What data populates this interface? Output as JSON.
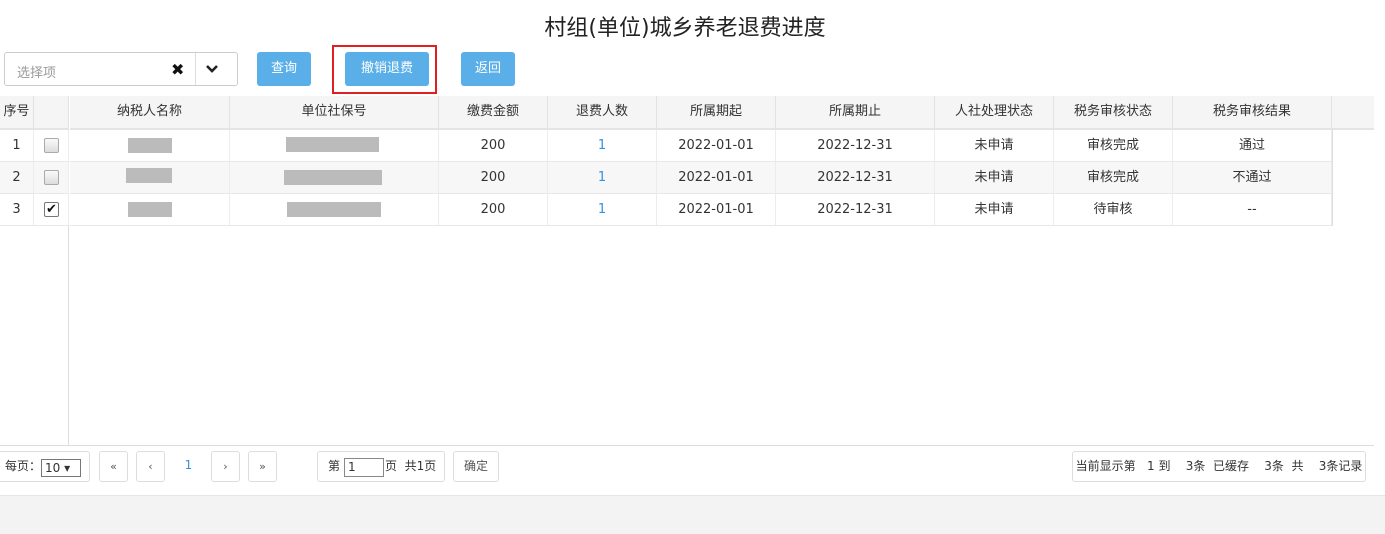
{
  "page_title": "村组(单位)城乡养老退费进度",
  "toolbar": {
    "select_placeholder": "选择项",
    "clear_icon": "✖",
    "query_label": "查询",
    "revoke_label": "撤销退费",
    "back_label": "返回"
  },
  "table": {
    "headers": {
      "seq": "序号",
      "name": "纳税人名称",
      "social_no": "单位社保号",
      "amount": "缴费金额",
      "refund_count": "退费人数",
      "period_start": "所属期起",
      "period_end": "所属期止",
      "hr_status": "人社处理状态",
      "tax_status": "税务审核状态",
      "tax_result": "税务审核结果"
    },
    "rows": [
      {
        "seq": "1",
        "checked": false,
        "amount": "200",
        "refund_count": "1",
        "period_start": "2022-01-01",
        "period_end": "2022-12-31",
        "hr_status": "未申请",
        "tax_status": "审核完成",
        "tax_result": "通过"
      },
      {
        "seq": "2",
        "checked": false,
        "amount": "200",
        "refund_count": "1",
        "period_start": "2022-01-01",
        "period_end": "2022-12-31",
        "hr_status": "未申请",
        "tax_status": "审核完成",
        "tax_result": "不通过"
      },
      {
        "seq": "3",
        "checked": true,
        "amount": "200",
        "refund_count": "1",
        "period_start": "2022-01-01",
        "period_end": "2022-12-31",
        "hr_status": "未申请",
        "tax_status": "待审核",
        "tax_result": "--"
      }
    ]
  },
  "pager": {
    "per_page_label": "每页：",
    "per_page_value": "10 ▾",
    "first": "«",
    "prev": "‹",
    "current": "1",
    "next": "›",
    "last": "»",
    "page_prefix": "第",
    "page_input": "1",
    "page_suffix": "页  共1页",
    "confirm": "确定",
    "summary": "当前显示第   1 到    3条  已缓存    3条  共    3条记录"
  }
}
